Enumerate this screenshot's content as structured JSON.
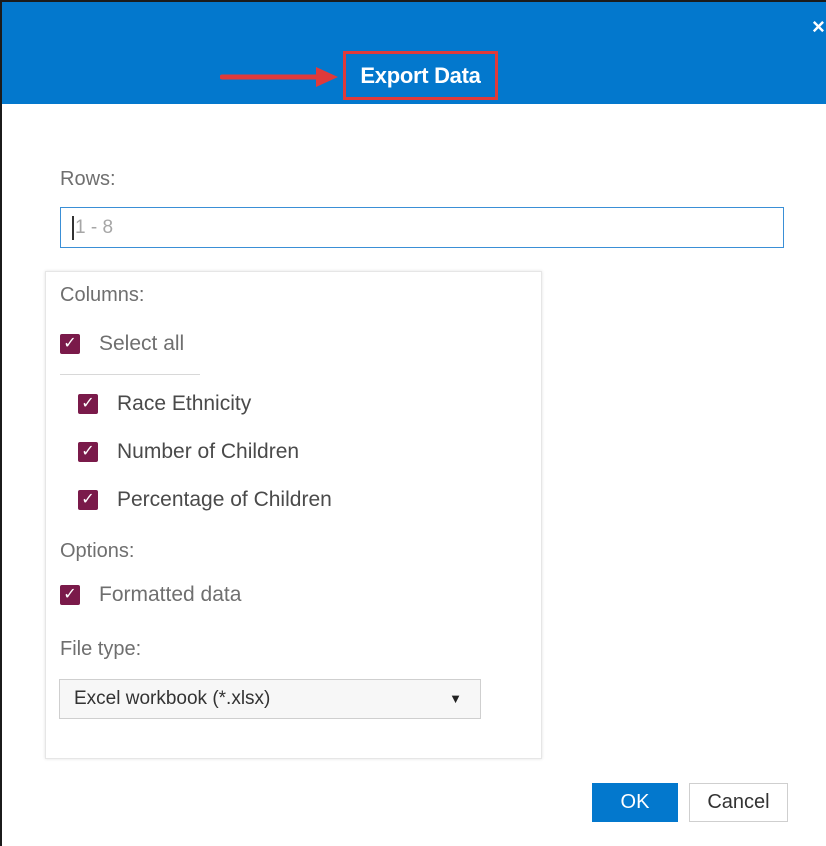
{
  "dialog": {
    "title": "Export Data",
    "close_icon": "close-icon",
    "accent_color": "#0378cd",
    "highlight_color": "#e03a3a"
  },
  "rows": {
    "label": "Rows:",
    "placeholder": "1 - 8",
    "value": ""
  },
  "columns": {
    "label": "Columns:",
    "select_all": {
      "label": "Select all",
      "checked": true
    },
    "items": [
      {
        "label": "Race Ethnicity",
        "checked": true
      },
      {
        "label": "Number of Children",
        "checked": true
      },
      {
        "label": "Percentage of Children",
        "checked": true
      }
    ]
  },
  "options": {
    "label": "Options:",
    "formatted_data": {
      "label": "Formatted data",
      "checked": true
    }
  },
  "file_type": {
    "label": "File type:",
    "selected": "Excel workbook (*.xlsx)"
  },
  "buttons": {
    "ok": "OK",
    "cancel": "Cancel"
  },
  "checkbox_color": "#7a1a4a"
}
